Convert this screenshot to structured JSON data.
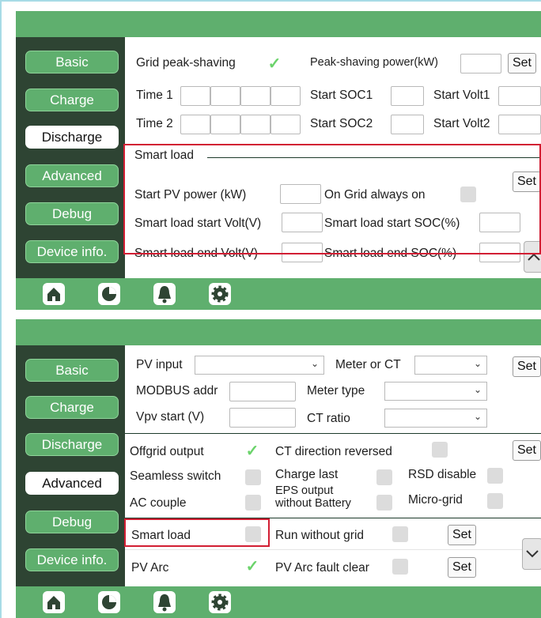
{
  "top": {
    "nav": [
      {
        "label": "Basic",
        "active": false
      },
      {
        "label": "Charge",
        "active": false
      },
      {
        "label": "Discharge",
        "active": true
      },
      {
        "label": "Advanced",
        "active": false
      },
      {
        "label": "Debug",
        "active": false
      },
      {
        "label": "Device info.",
        "active": false
      }
    ],
    "grid_peak": "Grid peak-shaving",
    "peak_power": "Peak-shaving power(kW)",
    "set": "Set",
    "time1": "Time 1",
    "time2": "Time 2",
    "start_soc1": "Start SOC1",
    "start_volt1": "Start Volt1",
    "start_soc2": "Start SOC2",
    "start_volt2": "Start Volt2",
    "smart_load": "Smart load",
    "start_pv_power": "Start PV power (kW)",
    "on_grid": "On Grid always on",
    "sl_start_volt": "Smart load start Volt(V)",
    "sl_start_soc": "Smart load start SOC(%)",
    "sl_end_volt": "Smart load end Volt(V)",
    "sl_end_soc": "Smart load end SOC(%)"
  },
  "bottom": {
    "nav": [
      {
        "label": "Basic",
        "active": false
      },
      {
        "label": "Charge",
        "active": false
      },
      {
        "label": "Discharge",
        "active": false
      },
      {
        "label": "Advanced",
        "active": true
      },
      {
        "label": "Debug",
        "active": false
      },
      {
        "label": "Device info.",
        "active": false
      }
    ],
    "pv_input": "PV input",
    "meter_or_ct": "Meter or CT",
    "set": "Set",
    "modbus": "MODBUS addr",
    "meter_type": "Meter type",
    "vpv_start": "Vpv start (V)",
    "ct_ratio": "CT ratio",
    "offgrid": "Offgrid output",
    "ct_dir": "CT direction reversed",
    "seamless": "Seamless switch",
    "charge_last": "Charge last",
    "rsd": "RSD disable",
    "ac_couple": "AC couple",
    "eps_line1": "EPS output",
    "eps_line2": "without Battery",
    "micro": "Micro-grid",
    "smart_load": "Smart load",
    "run_wo_grid": "Run without grid",
    "pv_arc": "PV Arc",
    "pv_arc_fault": "PV Arc fault clear"
  },
  "colors": {
    "green": "#5faf6e",
    "sidebar": "#2e4433",
    "highlight": "#d21e33",
    "check": "#6bd36b"
  },
  "icons": [
    "home-icon",
    "pie-chart-icon",
    "bell-icon",
    "gear-icon"
  ]
}
